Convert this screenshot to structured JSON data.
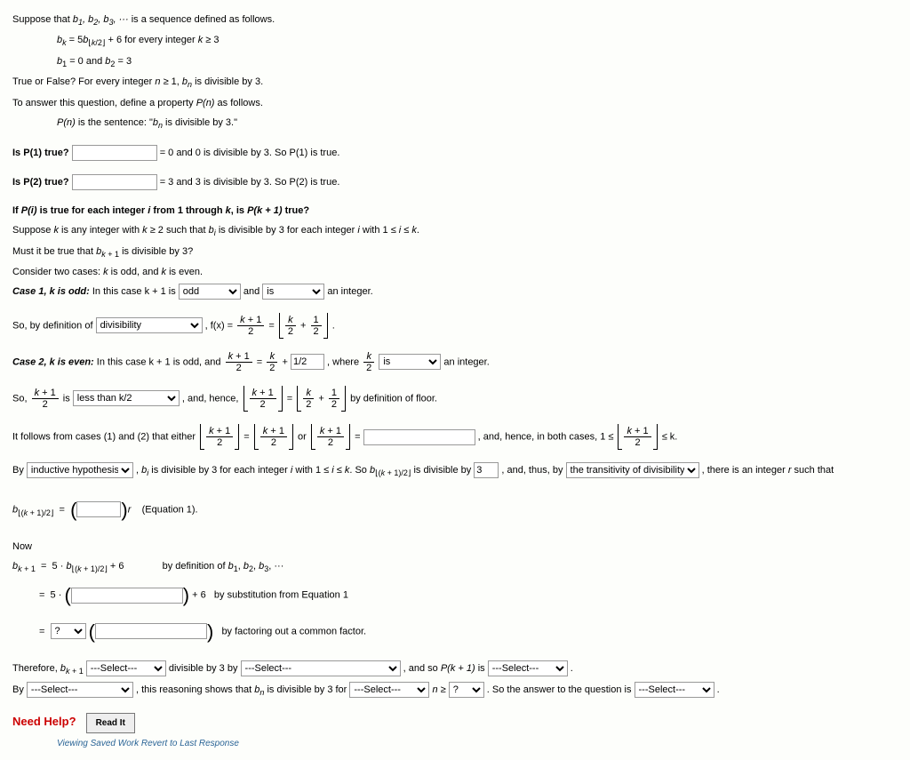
{
  "intro": {
    "l1a": "Suppose that ",
    "l1b": " is a sequence defined as follows.",
    "seq": "b₁, b₂, b₃, ···",
    "l2a": "bₖ = 5b",
    "l2sub": "⌊k/2⌋",
    "l2b": " + 6 for every integer k ≥ 3",
    "l3": "b₁ = 0 and b₂ = 3",
    "l4": "True or False? For every integer n ≥ 1, bₙ is divisible by 3.",
    "l5": "To answer this question, define a property P(n) as follows.",
    "l6": "P(n) is the sentence: \"bₙ is divisible by 3.\""
  },
  "p1": {
    "q": "Is P(1) true?",
    "a": "= 0 and 0 is divisible by 3. So P(1) is true."
  },
  "p2": {
    "q": "Is P(2) true?",
    "a": "= 3 and 3 is divisible by 3. So P(2) is true."
  },
  "pk": {
    "h": "If P(i) is true for each integer i from 1 through k, is P(k + 1) true?",
    "s1": "Suppose k is any integer with k ≥ 2 such that bᵢ is divisible by 3 for each integer i with 1 ≤ i ≤ k.",
    "s2": "Must it be true that bₖ ₊ ₁ is divisible by 3?",
    "s3": "Consider two cases: k is odd, and k is even."
  },
  "case1": {
    "h": "Case 1, k is odd:",
    "t1": " In this case k + 1 is ",
    "opt1": "odd",
    "t2": " and ",
    "opt2": "is",
    "t3": " an integer.",
    "def1": "So, by definition of ",
    "opt3": "divisibility",
    "def2": " , f(x) = "
  },
  "case2": {
    "h": "Case 2, k is even:",
    "t1": " In this case k + 1 is odd, and ",
    "t2": " , where ",
    "opt1": "is",
    "t3": " an integer.",
    "val1": "1/2",
    "so1": "So, ",
    "so2": " is ",
    "opt2": "less than k/2",
    "so3": " , and, hence, ",
    "so4": " by definition of floor."
  },
  "follows": {
    "t1": "It follows from cases (1) and (2) that either ",
    "t2": " or ",
    "t3": " , and, hence, in both cases, 1 ≤ ",
    "t4": " ≤ k."
  },
  "by1": {
    "t1": "By ",
    "opt1": "inductive hypothesis",
    "t2": " , bᵢ is divisible by 3 for each integer i with 1 ≤ i ≤ k. So b",
    "sub1": "⌊(k + 1)/2⌋",
    "t3": " is divisible by ",
    "val1": "3",
    "t4": " , and, thus, by ",
    "opt2": "the transitivity of divisibility",
    "t5": " , there is an integer r such that"
  },
  "eq1": {
    "lhs": "b",
    "sub": "⌊(k + 1)/2⌋",
    "t1": " = ",
    "t2": "r    (Equation 1)."
  },
  "now": {
    "h": "Now",
    "l1a": "bₖ ₊ ₁  =  5 · b",
    "l1sub": "⌊(k + 1)/2⌋",
    "l1b": " + 6",
    "r1": "by definition of b₁, b₂, b₃, ···",
    "l2a": "=  5 · ",
    "l2b": " + 6",
    "r2": "by substitution from Equation 1",
    "l3a": "= ",
    "opt1": "?",
    "r3": "by factoring out a common factor."
  },
  "therefore": {
    "t1": "Therefore, bₖ ₊ ₁ ",
    "opt1": "---Select---",
    "t2": " divisible by 3 by ",
    "opt2": "---Select---",
    "t3": " , and so P(k + 1) is ",
    "opt3": "---Select---",
    "t4": " ."
  },
  "final": {
    "t1": "By ",
    "opt1": "---Select---",
    "t2": " , this reasoning shows that bₙ is divisible by 3 for ",
    "opt2": "---Select---",
    "t3": " n ≥ ",
    "opt3": "?",
    "t4": " . So the answer to the question is ",
    "opt4": "---Select---",
    "t5": " ."
  },
  "help": {
    "label": "Need Help?",
    "btn": "Read It",
    "revert": "Viewing Saved Work Revert to Last Response"
  }
}
